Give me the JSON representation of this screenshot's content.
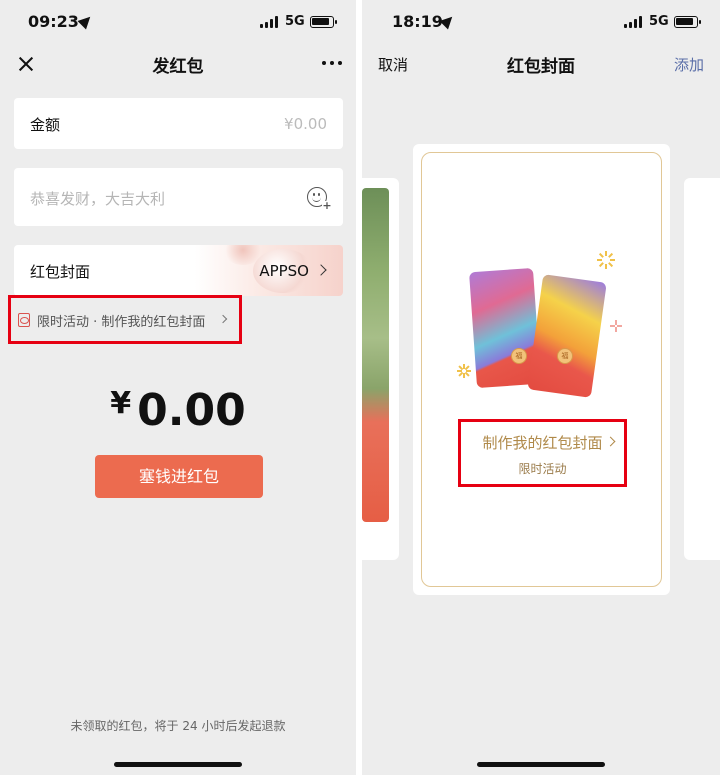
{
  "left": {
    "status": {
      "time": "09:23",
      "network": "5G"
    },
    "nav": {
      "title": "发红包"
    },
    "amount": {
      "label": "金额",
      "value": "¥0.00"
    },
    "greeting": {
      "placeholder": "恭喜发财，大吉大利"
    },
    "cover": {
      "label": "红包封面",
      "value": "APPSO"
    },
    "promo": {
      "text": "限时活动 · 制作我的红包封面"
    },
    "big_amount": {
      "symbol": "¥",
      "value": "0.00"
    },
    "send_button": "塞钱进红包",
    "footnote": "未领取的红包，将于 24 小时后发起退款"
  },
  "right": {
    "status": {
      "time": "18:19",
      "network": "5G"
    },
    "nav": {
      "left": "取消",
      "title": "红包封面",
      "right": "添加"
    },
    "cta": {
      "main": "制作我的红包封面",
      "sub": "限时活动"
    },
    "coin_text": "福"
  },
  "colors": {
    "send_button": "#ec6b4f",
    "highlight_box": "#e60012",
    "gold": "#b08a4a",
    "add_link": "#5a6ea8"
  }
}
